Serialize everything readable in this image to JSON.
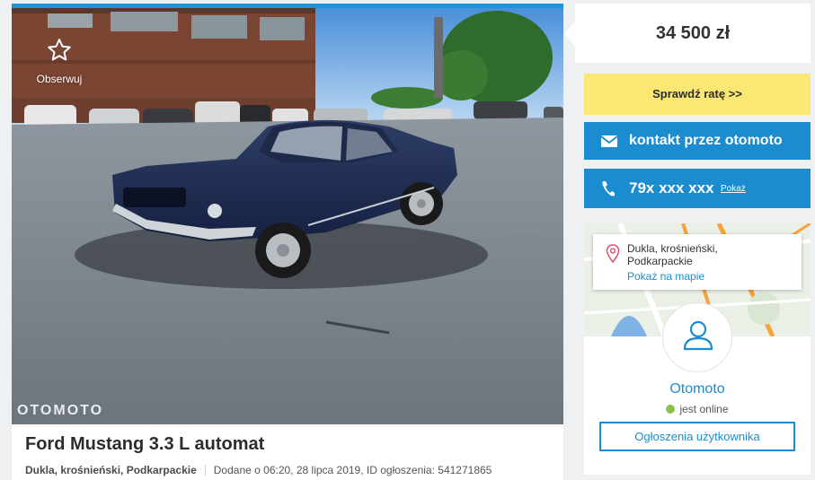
{
  "ad": {
    "follow_label": "Obserwuj",
    "watermark": "OTOMOTO",
    "title": "Ford Mustang 3.3 L automat",
    "location": "Dukla, krośnieński, Podkarpackie",
    "added": "Dodane o 06:20, 28 lipca 2019, ID ogłoszenia: 541271865"
  },
  "sidebar": {
    "price": "34 500 zł",
    "rate_button": "Sprawdź ratę >>",
    "contact_button": "kontakt przez otomoto",
    "phone": "79x xxx xxx",
    "phone_show": "Pokaż",
    "location": {
      "line1": "Dukla, krośnieński,",
      "line2": "Podkarpackie",
      "map_link": "Pokaż na mapie"
    },
    "seller": {
      "name": "Otomoto",
      "status": "jest online",
      "ads_button": "Ogłoszenia użytkownika"
    }
  },
  "colors": {
    "accent_blue": "#1b8ccf",
    "rate_yellow": "#fbe774",
    "online_green": "#8bc34a",
    "top_bar": "#1b95d8"
  },
  "icons": [
    "star-icon",
    "envelope-icon",
    "phone-icon",
    "location-pin-icon",
    "user-avatar-icon"
  ]
}
